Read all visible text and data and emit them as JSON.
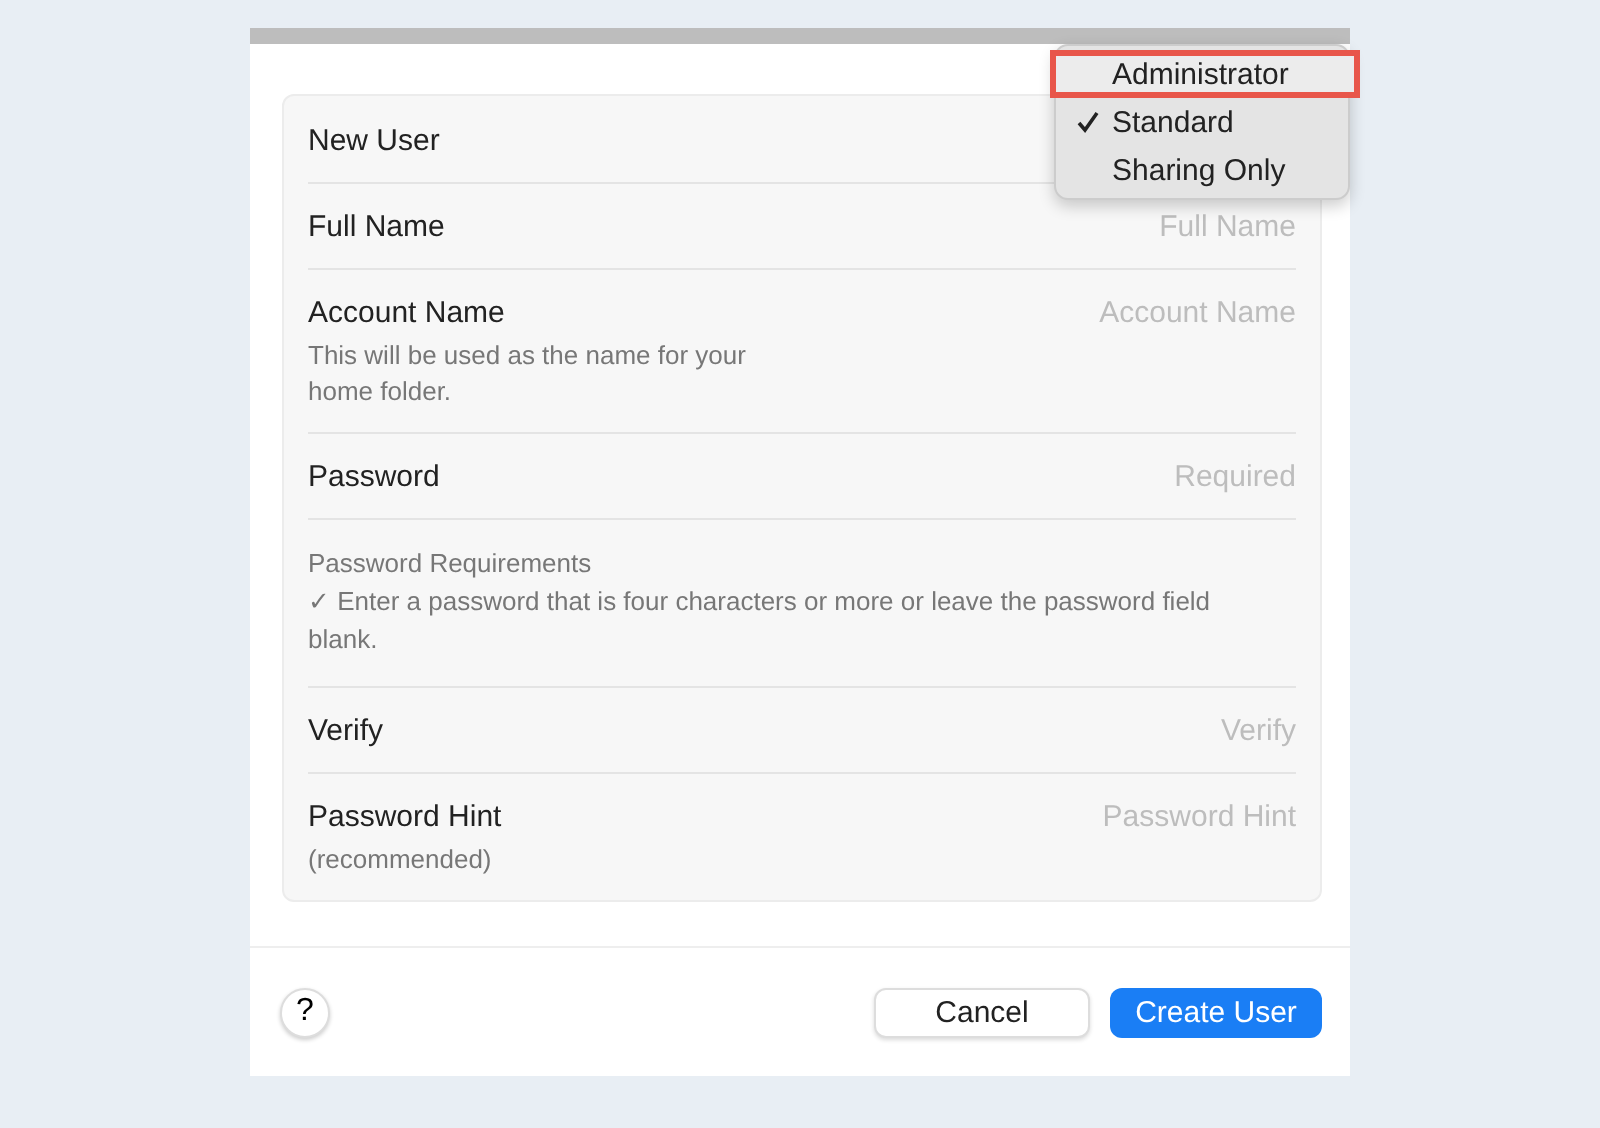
{
  "form": {
    "rows": [
      {
        "kind": "field",
        "label": "New User"
      },
      {
        "kind": "field",
        "label": "Full Name",
        "placeholder": "Full Name"
      },
      {
        "kind": "field",
        "label": "Account Name",
        "note": "This will be used as the name for your home folder.",
        "placeholder": "Account Name"
      },
      {
        "kind": "field",
        "label": "Password",
        "placeholder": "Required"
      },
      {
        "kind": "info",
        "title": "Password Requirements",
        "text": "✓ Enter a password that is four characters or more or leave the password field blank."
      },
      {
        "kind": "field",
        "label": "Verify",
        "placeholder": "Verify"
      },
      {
        "kind": "field",
        "label": "Password Hint",
        "note": "(recommended)",
        "placeholder": "Password Hint"
      }
    ]
  },
  "popup_menu": {
    "items": [
      {
        "label": "Administrator",
        "checked": false,
        "highlighted": true
      },
      {
        "label": "Standard",
        "checked": true,
        "highlighted": false
      },
      {
        "label": "Sharing Only",
        "checked": false,
        "highlighted": false
      }
    ]
  },
  "footer": {
    "help": "?",
    "buttons": [
      {
        "label": "Cancel",
        "kind": "secondary"
      },
      {
        "label": "Create User",
        "kind": "primary"
      }
    ]
  }
}
